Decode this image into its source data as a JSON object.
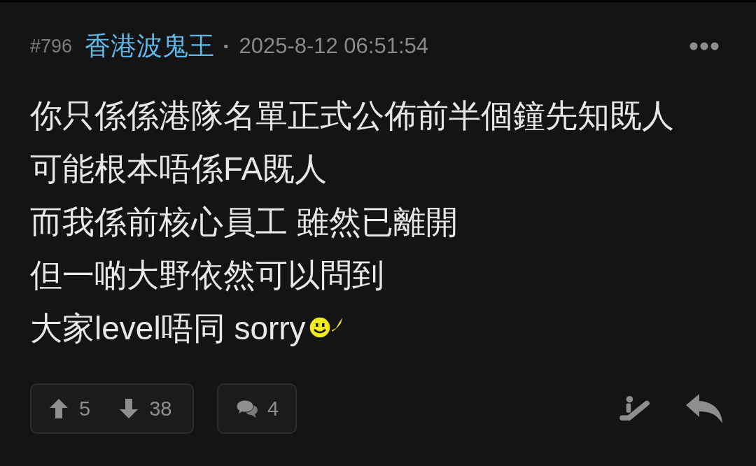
{
  "post": {
    "number": "#796",
    "author": "香港波鬼王",
    "separator": "·",
    "timestamp": "2025-8-12 06:51:54"
  },
  "body": {
    "lines": [
      "你只係係港隊名單正式公佈前半個鐘先知既人",
      "可能根本唔係FA既人",
      "而我係前核心員工 雖然已離開",
      "但一啲大野依然可以問到",
      "大家level唔同 sorry"
    ]
  },
  "actions": {
    "upvotes": "5",
    "downvotes": "38",
    "comments": "4"
  }
}
